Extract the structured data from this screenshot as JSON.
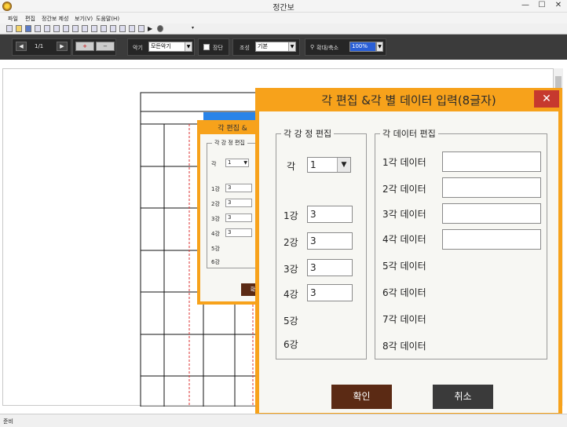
{
  "window": {
    "title": "정간보"
  },
  "menu": {
    "file": "파일",
    "edit": "편집",
    "jeonggan_create": "정간보 제성",
    "view": "보기(V)",
    "help": "도움말(H)"
  },
  "toolbar": {
    "page_indicator": "1/1",
    "instrument_label": "악기",
    "instrument_value": "모든악기",
    "jangdan_label": "장단",
    "key_label": "조성",
    "key_value": "기본",
    "zoom_label": "확대/축소",
    "zoom_value": "100%"
  },
  "status": {
    "text": "준비"
  },
  "bg_dialog": {
    "title": "각 편집 &",
    "group_label": "각 강 정 편집",
    "gak_label": "각",
    "gak_value": "1",
    "rows": [
      {
        "label": "1강",
        "value": "3"
      },
      {
        "label": "2강",
        "value": "3"
      },
      {
        "label": "3강",
        "value": "3"
      },
      {
        "label": "4강",
        "value": "3"
      },
      {
        "label": "5강",
        "value": ""
      },
      {
        "label": "6강",
        "value": ""
      }
    ],
    "ok_label": "확"
  },
  "dialog": {
    "title": "각 편집 &각 별 데이터 입력(8글자)",
    "close": "✕",
    "left_group_label": "각 강 정 편집",
    "gak_label": "각",
    "gak_value": "1",
    "gang_rows": [
      {
        "label": "1강",
        "value": "3"
      },
      {
        "label": "2강",
        "value": "3"
      },
      {
        "label": "3강",
        "value": "3"
      },
      {
        "label": "4강",
        "value": "3"
      },
      {
        "label": "5강"
      },
      {
        "label": "6강"
      }
    ],
    "right_group_label": "각 데이터 편집",
    "data_rows": [
      {
        "label": "1각 데이터",
        "value": ""
      },
      {
        "label": "2각 데이터",
        "value": ""
      },
      {
        "label": "3각 데이터",
        "value": ""
      },
      {
        "label": "4각 데이터",
        "value": ""
      },
      {
        "label": "5각 데이터"
      },
      {
        "label": "6각 데이터"
      },
      {
        "label": "7각 데이터"
      },
      {
        "label": "8각 데이터"
      }
    ],
    "ok_label": "확인",
    "cancel_label": "취소"
  },
  "colors": {
    "dialog_frame": "#f7a21b",
    "close_button": "#c6392e",
    "ok_button": "#5b2a14",
    "cancel_button": "#3a3a3a"
  }
}
